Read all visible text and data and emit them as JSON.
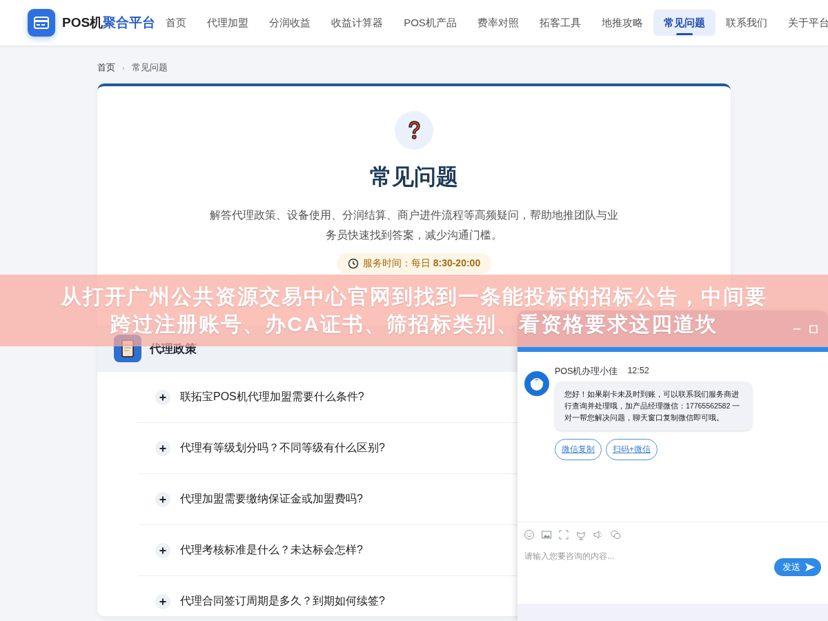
{
  "nav": {
    "brand_dark": "POS机",
    "brand_accent": "聚合平台",
    "items": [
      {
        "label": "首页",
        "selected": false
      },
      {
        "label": "代理加盟",
        "selected": false
      },
      {
        "label": "分润收益",
        "selected": false
      },
      {
        "label": "收益计算器",
        "selected": false
      },
      {
        "label": "POS机产品",
        "selected": false
      },
      {
        "label": "费率对照",
        "selected": false
      },
      {
        "label": "拓客工具",
        "selected": false
      },
      {
        "label": "地推攻略",
        "selected": false
      },
      {
        "label": "常见问题",
        "selected": true
      },
      {
        "label": "联系我们",
        "selected": false
      },
      {
        "label": "关于平台",
        "selected": false
      }
    ]
  },
  "breadcrumb": {
    "items": [
      "首页",
      "常见问题"
    ],
    "separator": "›"
  },
  "hero": {
    "title": "常见问题",
    "description": "解答代理政策、设备使用、分润结算、商户进件流程等高频疑问，帮助地推团队与业务员快速找到答案，减少沟通门槛。",
    "service_hours": "服务时间：每日 **8:30-20:00**"
  },
  "category": {
    "title": "代理政策",
    "questions": [
      {
        "text": "联拓宝POS机代理加盟需要什么条件?",
        "expanded": false
      },
      {
        "text": "代理有等级划分吗？不同等级有什么区别?",
        "expanded": false
      },
      {
        "text": "代理加盟需要缴纳保证金或加盟费吗?",
        "expanded": false
      },
      {
        "text": "代理考核标准是什么？未达标会怎样?",
        "expanded": false
      },
      {
        "text": "代理合同签订周期是多久？到期如何续签?",
        "expanded": false
      }
    ]
  },
  "chat": {
    "sender": "POS机办理小佳",
    "time": "12:52",
    "message": "您好！如果刷卡未及时到账，可以联系我们服务商进行查询并处理哦，加产品经理微信：17765562582 一对一帮您解决问题，聊天窗口复制微信即可哦。",
    "actions": [
      "微信复制",
      "扫码+微信"
    ],
    "input": {
      "placeholder": "请输入您要咨询的内容..."
    },
    "send": "发送"
  },
  "caption": {
    "lines": [
      "从打开广州公共资源交易中心官网到找到一条能投标的招标公告，中间要",
      "跨过注册账号、办CA证书、筛招标类别、看资格要求这四道坎"
    ]
  }
}
